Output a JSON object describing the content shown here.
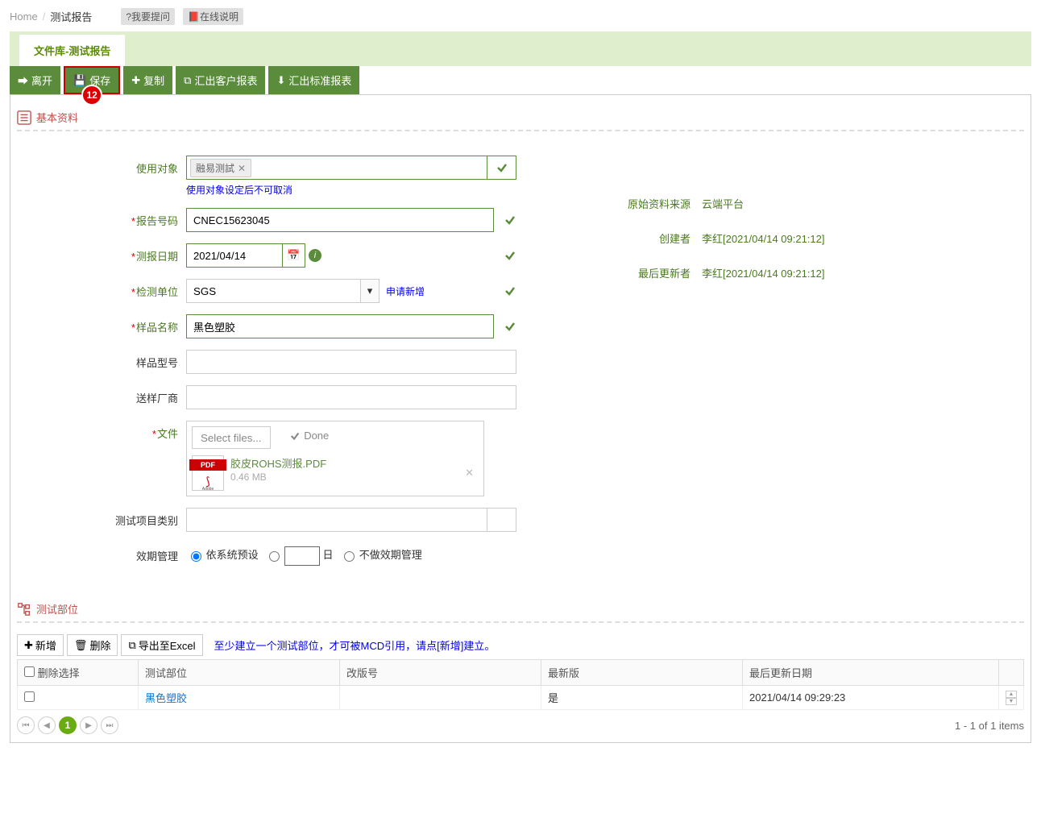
{
  "breadcrumb": {
    "home": "Home",
    "current": "测试报告"
  },
  "topButtons": {
    "ask": "?我要提问",
    "help": "在线说明"
  },
  "tab": {
    "label": "文件库-测试报告"
  },
  "actions": {
    "leave": "离开",
    "save": "保存",
    "copy": "复制",
    "exportCustomer": "汇出客户报表",
    "exportStandard": "汇出标准报表",
    "badge": "12"
  },
  "section": {
    "basic": "基本资料",
    "parts": "测试部位"
  },
  "form": {
    "target": {
      "label": "使用对象",
      "tag": "融易测試",
      "hint": "使用对象设定后不可取消"
    },
    "reportNo": {
      "label": "报告号码",
      "value": "CNEC15623045"
    },
    "reportDate": {
      "label": "测报日期",
      "value": "2021/04/14"
    },
    "unit": {
      "label": "检测单位",
      "value": "SGS",
      "applyNew": "申请新增"
    },
    "sampleName": {
      "label": "样品名称",
      "value": "黑色塑胶"
    },
    "sampleModel": {
      "label": "样品型号",
      "value": ""
    },
    "supplier": {
      "label": "送样厂商",
      "value": ""
    },
    "file": {
      "label": "文件",
      "select": "Select files...",
      "done": "Done",
      "name": "胶皮ROHS测报.PDF",
      "size": "0.46 MB",
      "pdf": "PDF",
      "adobe": "Adobe"
    },
    "testCat": {
      "label": "测试项目类别",
      "value": ""
    },
    "expire": {
      "label": "效期管理",
      "opt1": "依系统预设",
      "day": "日",
      "opt2": "不做效期管理"
    }
  },
  "meta": {
    "source": {
      "label": "原始资料来源",
      "value": "云端平台"
    },
    "creator": {
      "label": "创建者",
      "value": "李红[2021/04/14 09:21:12]"
    },
    "updater": {
      "label": "最后更新者",
      "value": "李红[2021/04/14 09:21:12]"
    }
  },
  "partsToolbar": {
    "add": "新增",
    "del": "删除",
    "export": "导出至Excel",
    "hint": "至少建立一个测试部位，才可被MCD引用，请点[新增]建立。"
  },
  "grid": {
    "cols": {
      "sel": "删除选择",
      "part": "测试部位",
      "rev": "改版号",
      "latest": "最新版",
      "updated": "最后更新日期"
    },
    "row": {
      "part": "黑色塑胶",
      "rev": "",
      "latest": "是",
      "updated": "2021/04/14 09:29:23"
    }
  },
  "pager": {
    "page": "1",
    "info": "1 - 1 of 1 items"
  }
}
